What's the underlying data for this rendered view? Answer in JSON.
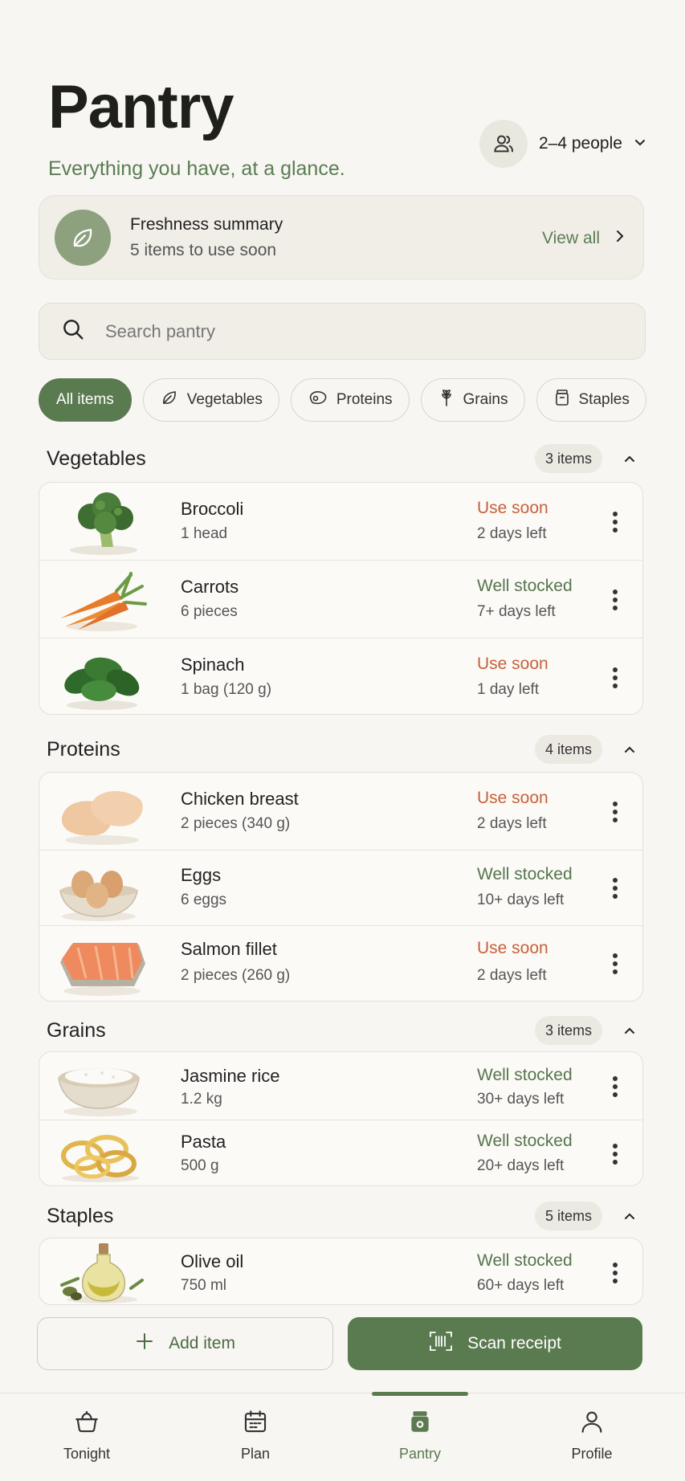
{
  "header": {
    "title": "Pantry",
    "subtitle": "Everything you have, at a glance.",
    "people_label": "2–4 people"
  },
  "freshness": {
    "title": "Freshness summary",
    "subtitle": "5 items to use soon",
    "view_all": "View all"
  },
  "search": {
    "placeholder": "Search pantry"
  },
  "filters": [
    {
      "label": "All items",
      "icon": "none",
      "active": true
    },
    {
      "label": "Vegetables",
      "icon": "leaf-icon"
    },
    {
      "label": "Proteins",
      "icon": "meat-icon"
    },
    {
      "label": "Grains",
      "icon": "wheat-icon"
    },
    {
      "label": "Staples",
      "icon": "jar-icon"
    }
  ],
  "sections": [
    {
      "title": "Vegetables",
      "count": "3 items",
      "items": [
        {
          "name": "Broccoli",
          "qty": "1 head",
          "status": "Use soon",
          "days": "2 days left",
          "image": "broccoli"
        },
        {
          "name": "Carrots",
          "qty": "6 pieces",
          "status": "Well stocked",
          "days": "7+ days left",
          "image": "carrots"
        },
        {
          "name": "Spinach",
          "qty": "1 bag (120 g)",
          "status": "Use soon",
          "days": "1 day left",
          "image": "spinach"
        }
      ]
    },
    {
      "title": "Proteins",
      "count": "4 items",
      "items": [
        {
          "name": "Chicken breast",
          "qty": "2 pieces (340 g)",
          "status": "Use soon",
          "days": "2 days left",
          "image": "chicken"
        },
        {
          "name": "Eggs",
          "qty": "6 eggs",
          "status": "Well stocked",
          "days": "10+ days left",
          "image": "eggs"
        },
        {
          "name": "Salmon fillet",
          "qty": "2 pieces (260 g)",
          "status": "Use soon",
          "days": "2 days left",
          "image": "salmon"
        }
      ]
    },
    {
      "title": "Grains",
      "count": "3 items",
      "items": [
        {
          "name": "Jasmine rice",
          "qty": "1.2 kg",
          "status": "Well stocked",
          "days": "30+ days left",
          "image": "rice"
        },
        {
          "name": "Pasta",
          "qty": "500 g",
          "status": "Well stocked",
          "days": "20+ days left",
          "image": "pasta"
        }
      ]
    },
    {
      "title": "Staples",
      "count": "5 items",
      "items": [
        {
          "name": "Olive oil",
          "qty": "750 ml",
          "status": "Well stocked",
          "days": "60+ days left",
          "image": "olive-oil"
        }
      ]
    }
  ],
  "actions": {
    "add_label": "Add item",
    "scan_label": "Scan receipt"
  },
  "tabs": [
    {
      "label": "Tonight",
      "icon": "pot-icon"
    },
    {
      "label": "Plan",
      "icon": "calendar-icon"
    },
    {
      "label": "Pantry",
      "icon": "pantry-jar-icon",
      "active": true
    },
    {
      "label": "Profile",
      "icon": "person-icon"
    }
  ],
  "colors": {
    "accent": "#5a7a50",
    "use_soon": "#c8603a",
    "background": "#f8f6f2"
  }
}
